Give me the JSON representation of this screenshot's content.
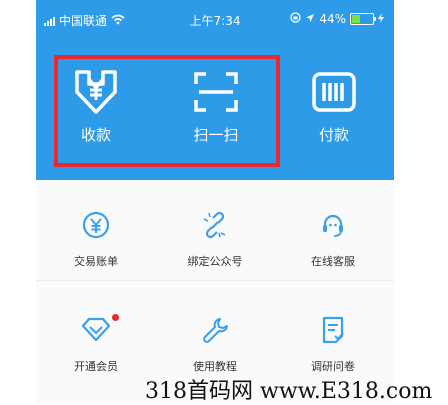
{
  "status_bar": {
    "carrier": "中国联通",
    "time": "上午7:34",
    "battery": "44%",
    "battery_level": 0.44
  },
  "header": {
    "actions": [
      {
        "label": "收款",
        "icon": "yuan-download-icon"
      },
      {
        "label": "扫一扫",
        "icon": "scan-icon"
      },
      {
        "label": "付款",
        "icon": "barcode-icon"
      }
    ],
    "highlight_color": "#e8292e",
    "background_color": "#2d9be8"
  },
  "grid": {
    "items": [
      {
        "label": "交易账单",
        "icon": "bill-icon"
      },
      {
        "label": "绑定公众号",
        "icon": "link-icon"
      },
      {
        "label": "在线客服",
        "icon": "headset-icon"
      },
      {
        "label": "开通会员",
        "icon": "diamond-icon",
        "badge": true
      },
      {
        "label": "使用教程",
        "icon": "wrench-icon"
      },
      {
        "label": "调研问卷",
        "icon": "survey-icon"
      }
    ]
  },
  "watermark": "318首码网 www.E318.com"
}
